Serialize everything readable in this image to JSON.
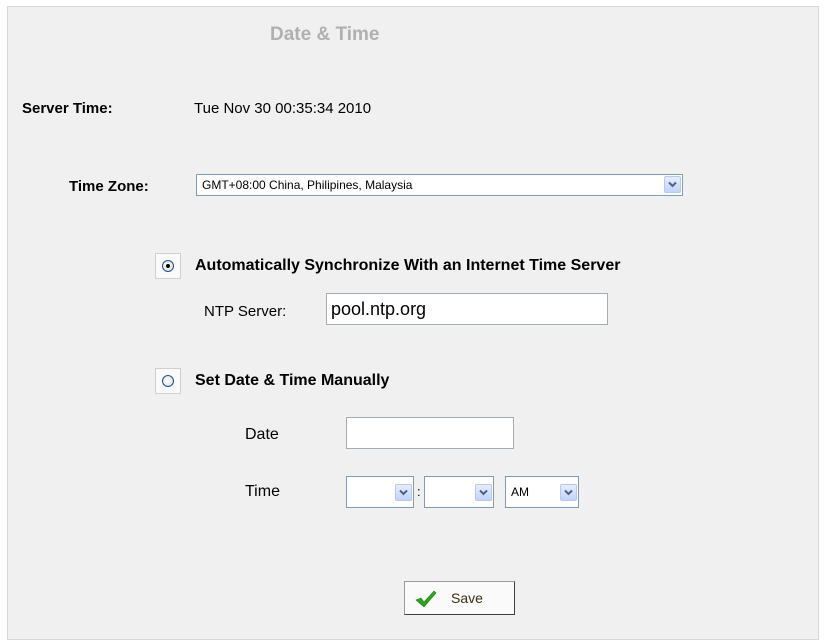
{
  "page": {
    "title": "Date & Time"
  },
  "server_time": {
    "label": "Server Time:",
    "value": "Tue Nov 30 00:35:34 2010"
  },
  "time_zone": {
    "label": "Time Zone:",
    "selected": "GMT+08:00 China, Philipines, Malaysia"
  },
  "auto_sync": {
    "label": "Automatically Synchronize With an Internet Time Server",
    "checked": true,
    "ntp_label": "NTP Server:",
    "ntp_value": "pool.ntp.org"
  },
  "manual": {
    "label": "Set Date & Time Manually",
    "checked": false,
    "date_label": "Date",
    "date_value": "",
    "time_label": "Time",
    "hour_value": "",
    "minute_value": "",
    "separator": ":",
    "ampm_value": "AM"
  },
  "actions": {
    "save_label": "Save"
  },
  "colors": {
    "title": "#b0b0b0",
    "panel_bg": "#f0f0f0",
    "save_check": "#2fa51f",
    "dropdown_arrow": "#4d6185"
  },
  "icons": {
    "dropdown": "chevron-down-icon",
    "save": "check-icon"
  }
}
